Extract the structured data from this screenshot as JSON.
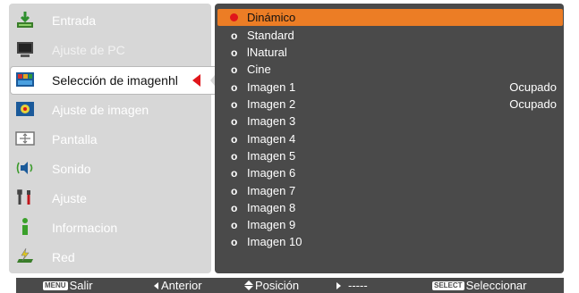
{
  "menu": {
    "items": [
      {
        "label": "Entrada",
        "icon": "input-icon",
        "state": "normal"
      },
      {
        "label": "Ajuste de PC",
        "icon": "pc-monitor-icon",
        "state": "disabled"
      },
      {
        "label": "Selección de imagenhl",
        "icon": "image-select-icon",
        "state": "selected"
      },
      {
        "label": "Ajuste de imagen",
        "icon": "image-adjust-icon",
        "state": "normal"
      },
      {
        "label": "Pantalla",
        "icon": "screen-icon",
        "state": "normal"
      },
      {
        "label": "Sonido",
        "icon": "speaker-icon",
        "state": "normal"
      },
      {
        "label": "Ajuste",
        "icon": "tools-icon",
        "state": "normal"
      },
      {
        "label": "Informacion",
        "icon": "info-icon",
        "state": "normal"
      },
      {
        "label": "Red",
        "icon": "network-icon",
        "state": "normal"
      }
    ]
  },
  "image_modes": {
    "items": [
      {
        "label": "Dinámico",
        "status": "",
        "selected": true
      },
      {
        "label": "Standard",
        "status": "",
        "selected": false
      },
      {
        "label": "lNatural",
        "status": "",
        "selected": false
      },
      {
        "label": "Cine",
        "status": "",
        "selected": false
      },
      {
        "label": "Imagen 1",
        "status": "Ocupado",
        "selected": false
      },
      {
        "label": "Imagen 2",
        "status": "Ocupado",
        "selected": false
      },
      {
        "label": "Imagen 3",
        "status": "",
        "selected": false
      },
      {
        "label": "Imagen 4",
        "status": "",
        "selected": false
      },
      {
        "label": "Imagen 5",
        "status": "",
        "selected": false
      },
      {
        "label": "Imagen 6",
        "status": "",
        "selected": false
      },
      {
        "label": "Imagen 7",
        "status": "",
        "selected": false
      },
      {
        "label": "Imagen 8",
        "status": "",
        "selected": false
      },
      {
        "label": "Imagen 9",
        "status": "",
        "selected": false
      },
      {
        "label": "Imagen 10",
        "status": "",
        "selected": false
      }
    ],
    "bullet_char": "o"
  },
  "footer": {
    "menu_key": "MENU",
    "exit_label": "Salir",
    "previous_label": "Anterior",
    "position_label": "Posición",
    "next_label": "-----",
    "select_key": "SELECT",
    "select_label": "Seleccionar"
  },
  "colors": {
    "left_panel_bg": "#d7d7d7",
    "right_panel_bg": "#4a4a4a",
    "highlight_orange": "#ec7d25",
    "accent_red": "#e0161b"
  }
}
